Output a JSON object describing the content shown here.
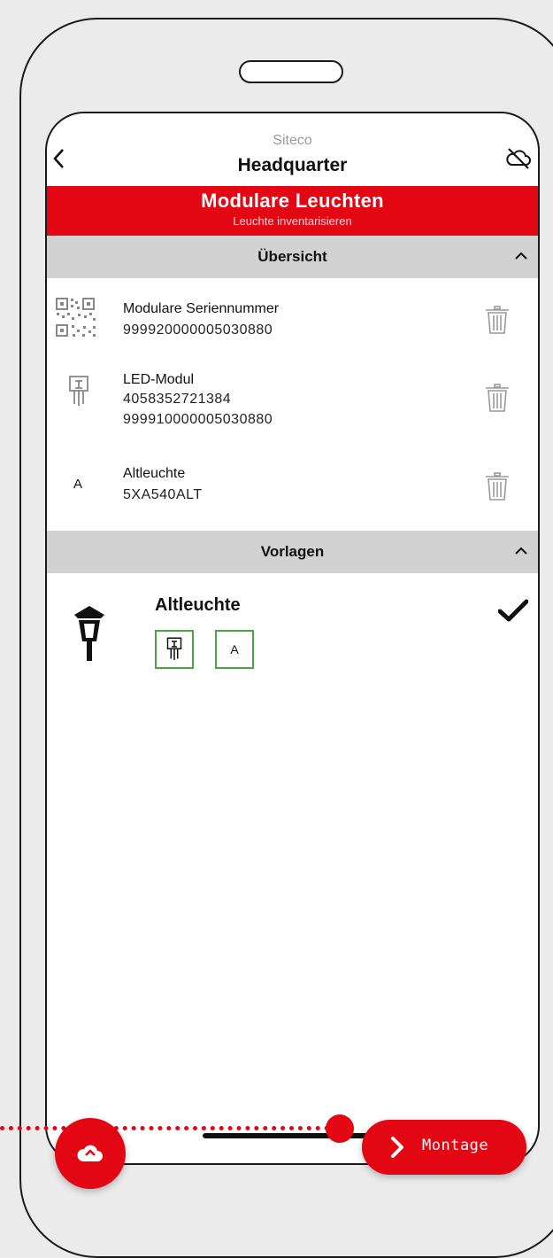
{
  "header": {
    "subtitle": "Siteco",
    "title": "Headquarter"
  },
  "banner": {
    "title": "Modulare Leuchten",
    "subtitle": "Leuchte inventarisieren"
  },
  "overview": {
    "label": "Übersicht",
    "items": [
      {
        "name": "Modulare Seriennummer",
        "values": [
          "999920000005030880"
        ],
        "icon": "qr-code-icon"
      },
      {
        "name": "LED-Modul",
        "values": [
          "4058352721384",
          "999910000005030880"
        ],
        "icon": "led-module-icon"
      },
      {
        "name": "Altleuchte",
        "values": [
          "5XA540ALT"
        ],
        "icon": "letter-a-icon",
        "icon_text": "A"
      }
    ]
  },
  "templates": {
    "label": "Vorlagen",
    "item_title": "Altleuchte",
    "badge_text": "A"
  },
  "actions": {
    "montage_label": "Montage"
  },
  "colors": {
    "accent": "#e30613",
    "section_bg": "#d2d2d2",
    "badge_border": "#4aa544"
  }
}
